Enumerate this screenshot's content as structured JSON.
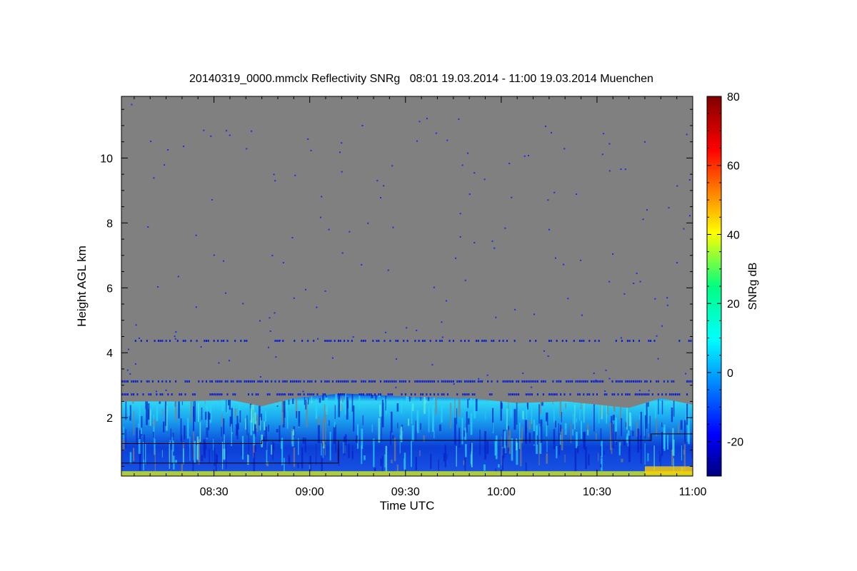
{
  "chart_data": {
    "type": "heatmap",
    "title": "20140319_0000.mmclx Reflectivity SNRg   08:01 19.03.2014 - 11:00 19.03.2014 Muenchen",
    "xlabel": "Time UTC",
    "ylabel": "Height AGL km",
    "colorbar_label": "SNRg dB",
    "x_ticks": [
      "08:30",
      "09:00",
      "09:30",
      "10:00",
      "10:30",
      "11:00"
    ],
    "x_range": [
      "08:01",
      "11:00"
    ],
    "y_ticks": [
      2,
      4,
      6,
      8,
      10
    ],
    "ylim": [
      0.2,
      11.9
    ],
    "colorbar_ticks": [
      -20,
      0,
      20,
      40,
      60,
      80
    ],
    "colorbar_range": [
      -30,
      80
    ],
    "colormap": "jet",
    "background_color": "#808080",
    "line_color": "#000000",
    "cloud_top_km": [
      {
        "time": "08:01",
        "top": 2.5
      },
      {
        "time": "08:20",
        "top": 2.5
      },
      {
        "time": "08:35",
        "top": 2.55
      },
      {
        "time": "08:45",
        "top": 2.35
      },
      {
        "time": "08:55",
        "top": 2.6
      },
      {
        "time": "09:10",
        "top": 2.75
      },
      {
        "time": "09:30",
        "top": 2.65
      },
      {
        "time": "09:50",
        "top": 2.6
      },
      {
        "time": "10:05",
        "top": 2.45
      },
      {
        "time": "10:20",
        "top": 2.5
      },
      {
        "time": "10:40",
        "top": 2.3
      },
      {
        "time": "10:50",
        "top": 2.6
      },
      {
        "time": "11:00",
        "top": 2.4
      }
    ],
    "upper_line_km": [
      {
        "time": "08:01",
        "height": 1.2
      },
      {
        "time": "08:45",
        "height": 1.2
      },
      {
        "time": "08:45",
        "height": 1.3
      },
      {
        "time": "10:47",
        "height": 1.3
      },
      {
        "time": "10:47",
        "height": 1.5
      },
      {
        "time": "11:00",
        "height": 1.5
      }
    ],
    "lower_line_km": [
      {
        "time": "08:01",
        "height": 0.6
      },
      {
        "time": "09:09",
        "height": 0.6
      },
      {
        "time": "09:09",
        "height": 1.3
      }
    ]
  }
}
